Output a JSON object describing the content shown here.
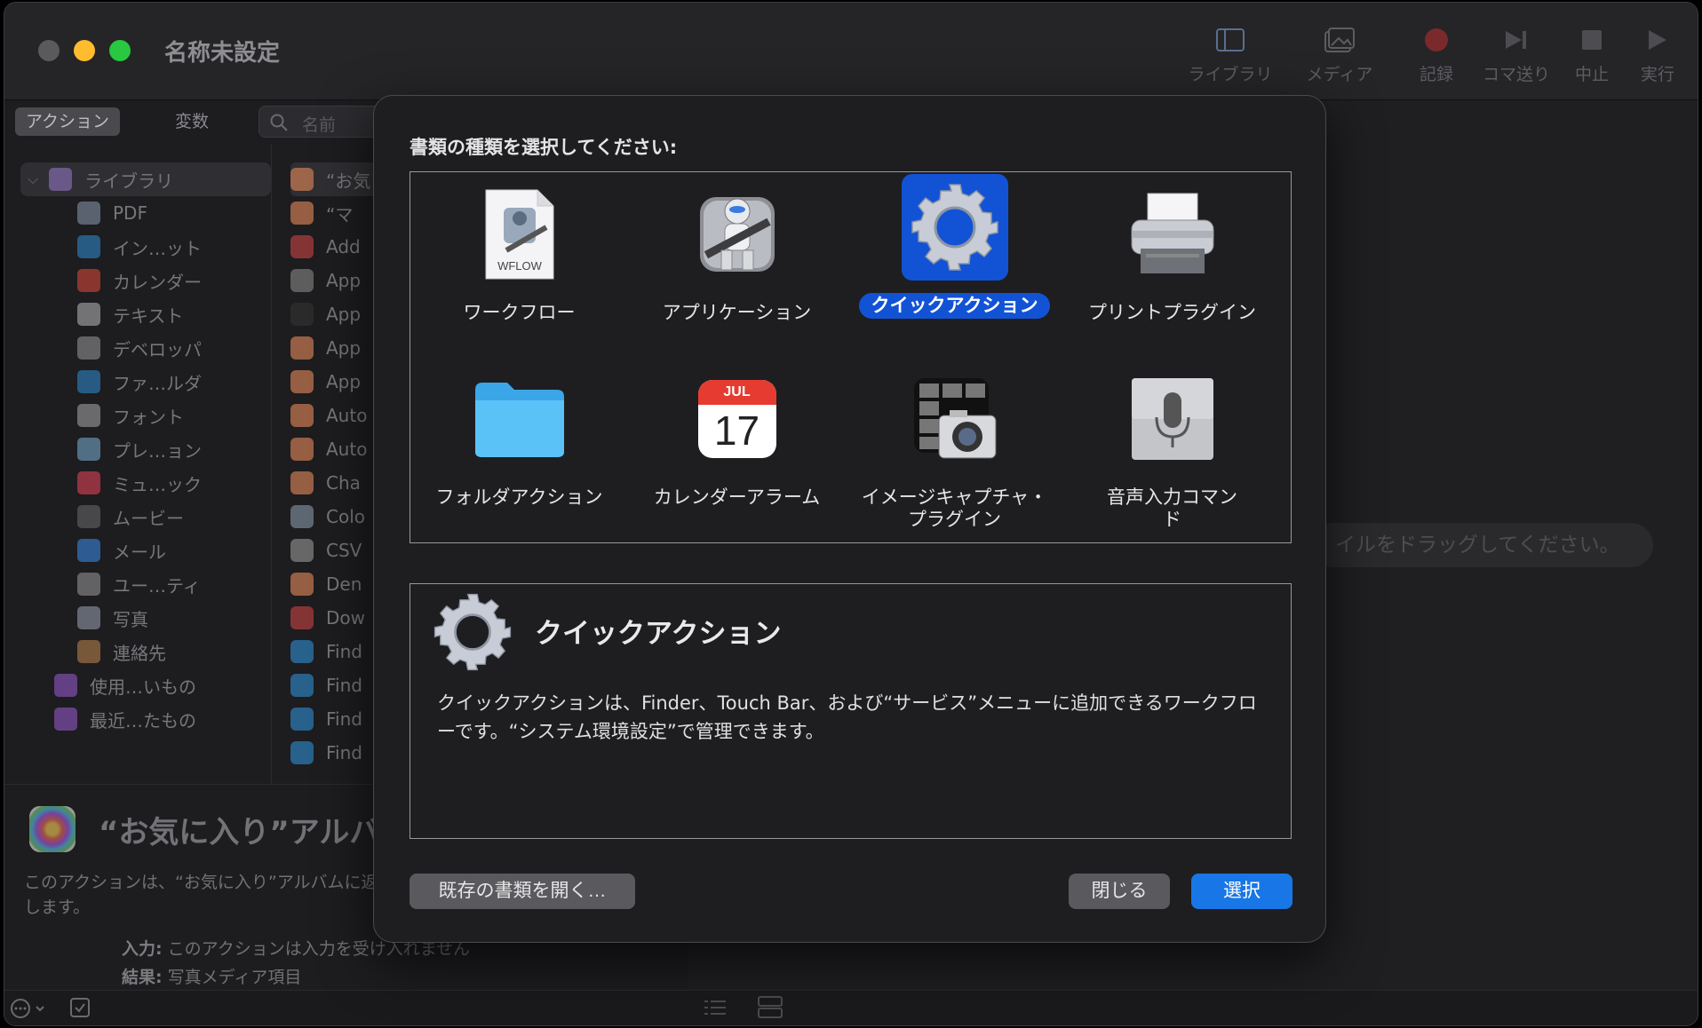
{
  "window": {
    "title": "名称未設定"
  },
  "toolbar": {
    "library": "ライブラリ",
    "media": "メディア",
    "record": "記録",
    "step": "コマ送り",
    "stop": "中止",
    "run": "実行"
  },
  "left": {
    "segments": [
      "アクション",
      "変数"
    ],
    "search_placeholder": "名前",
    "library": [
      {
        "label": "ライブラリ",
        "icon": "library-icon",
        "color": "#9a7bd1"
      },
      {
        "label": "PDF",
        "icon": "pdf-icon",
        "color": "#8d9bb0"
      },
      {
        "label": "イン…ット",
        "icon": "globe-icon",
        "color": "#2f8fd6"
      },
      {
        "label": "カレンダー",
        "icon": "calendar-icon",
        "color": "#e54a3c"
      },
      {
        "label": "テキスト",
        "icon": "text-icon",
        "color": "#b9b9b9"
      },
      {
        "label": "デベロッパ",
        "icon": "developer-icon",
        "color": "#9a9a9a"
      },
      {
        "label": "ファ…ルダ",
        "icon": "finder-icon",
        "color": "#2f8fd6"
      },
      {
        "label": "フォント",
        "icon": "font-icon",
        "color": "#aaaaaa"
      },
      {
        "label": "プレ…ョン",
        "icon": "presentation-icon",
        "color": "#7ab4d8"
      },
      {
        "label": "ミュ…ック",
        "icon": "music-icon",
        "color": "#f0455b"
      },
      {
        "label": "ムービー",
        "icon": "movie-icon",
        "color": "#6c6c6c"
      },
      {
        "label": "メール",
        "icon": "mail-icon",
        "color": "#3b90f0"
      },
      {
        "label": "ユー…ティ",
        "icon": "utility-icon",
        "color": "#9a9a9a"
      },
      {
        "label": "写真",
        "icon": "photos-icon",
        "color": "#9aa6b4"
      },
      {
        "label": "連絡先",
        "icon": "contacts-icon",
        "color": "#c28a4d"
      },
      {
        "label": "使用…いもの",
        "icon": "smart-folder-icon",
        "color": "#9c5fd6"
      },
      {
        "label": "最近…たもの",
        "icon": "smart-folder-icon",
        "color": "#9c5fd6"
      }
    ],
    "actions": [
      {
        "label": "“お気",
        "color": "#e88b5a"
      },
      {
        "label": "“マ",
        "color": "#e88b5a"
      },
      {
        "label": "Add",
        "color": "#c44"
      },
      {
        "label": "App",
        "color": "#888"
      },
      {
        "label": "App",
        "color": "#333"
      },
      {
        "label": "App",
        "color": "#e88b5a"
      },
      {
        "label": "App",
        "color": "#e88b5a"
      },
      {
        "label": "Auto",
        "color": "#e88b5a"
      },
      {
        "label": "Auto",
        "color": "#e88b5a"
      },
      {
        "label": "Cha",
        "color": "#e88b5a"
      },
      {
        "label": "Colo",
        "color": "#8899aa"
      },
      {
        "label": "CSV",
        "color": "#999"
      },
      {
        "label": "Den",
        "color": "#e88b5a"
      },
      {
        "label": "Dow",
        "color": "#c44"
      },
      {
        "label": "Find",
        "color": "#2f8fd6"
      },
      {
        "label": "Find",
        "color": "#2f8fd6"
      },
      {
        "label": "Find",
        "color": "#2f8fd6"
      },
      {
        "label": "Find",
        "color": "#2f8fd6"
      }
    ]
  },
  "description": {
    "title": "“お気に入り”アルバ",
    "text": "このアクションは、“お気に入り”アルバムに返します。",
    "input_label": "入力:",
    "input_value": "このアクションは入力を受け入れません",
    "result_label": "結果:",
    "result_value": "写真メディア項目"
  },
  "drop_hint": "イルをドラッグしてください。",
  "modal": {
    "prompt": "書類の種類を選択してください:",
    "types": [
      {
        "label": "ワークフロー",
        "icon": "workflow-icon"
      },
      {
        "label": "アプリケーション",
        "icon": "automator-robot-icon"
      },
      {
        "label": "クイックアクション",
        "icon": "gear-icon",
        "selected": true
      },
      {
        "label": "プリントプラグイン",
        "icon": "printer-icon"
      },
      {
        "label": "フォルダアクション",
        "icon": "folder-icon"
      },
      {
        "label": "カレンダーアラーム",
        "icon": "calendar-icon"
      },
      {
        "label": "イメージキャプチャ・プラグイン",
        "icon": "camera-icon"
      },
      {
        "label": "音声入力コマンド",
        "icon": "microphone-icon"
      }
    ],
    "workflow_badge": "WFLOW",
    "calendar_month": "JUL",
    "calendar_day": "17",
    "info_title": "クイックアクション",
    "info_text": "クイックアクションは、Finder、Touch Bar、および“サービス”メニューに追加できるワークフローです。“システム環境設定”で管理できます。",
    "open_existing": "既存の書類を開く…",
    "close": "閉じる",
    "choose": "選択"
  },
  "colors": {
    "accent": "#1253d6",
    "button_primary": "#1976e6"
  }
}
